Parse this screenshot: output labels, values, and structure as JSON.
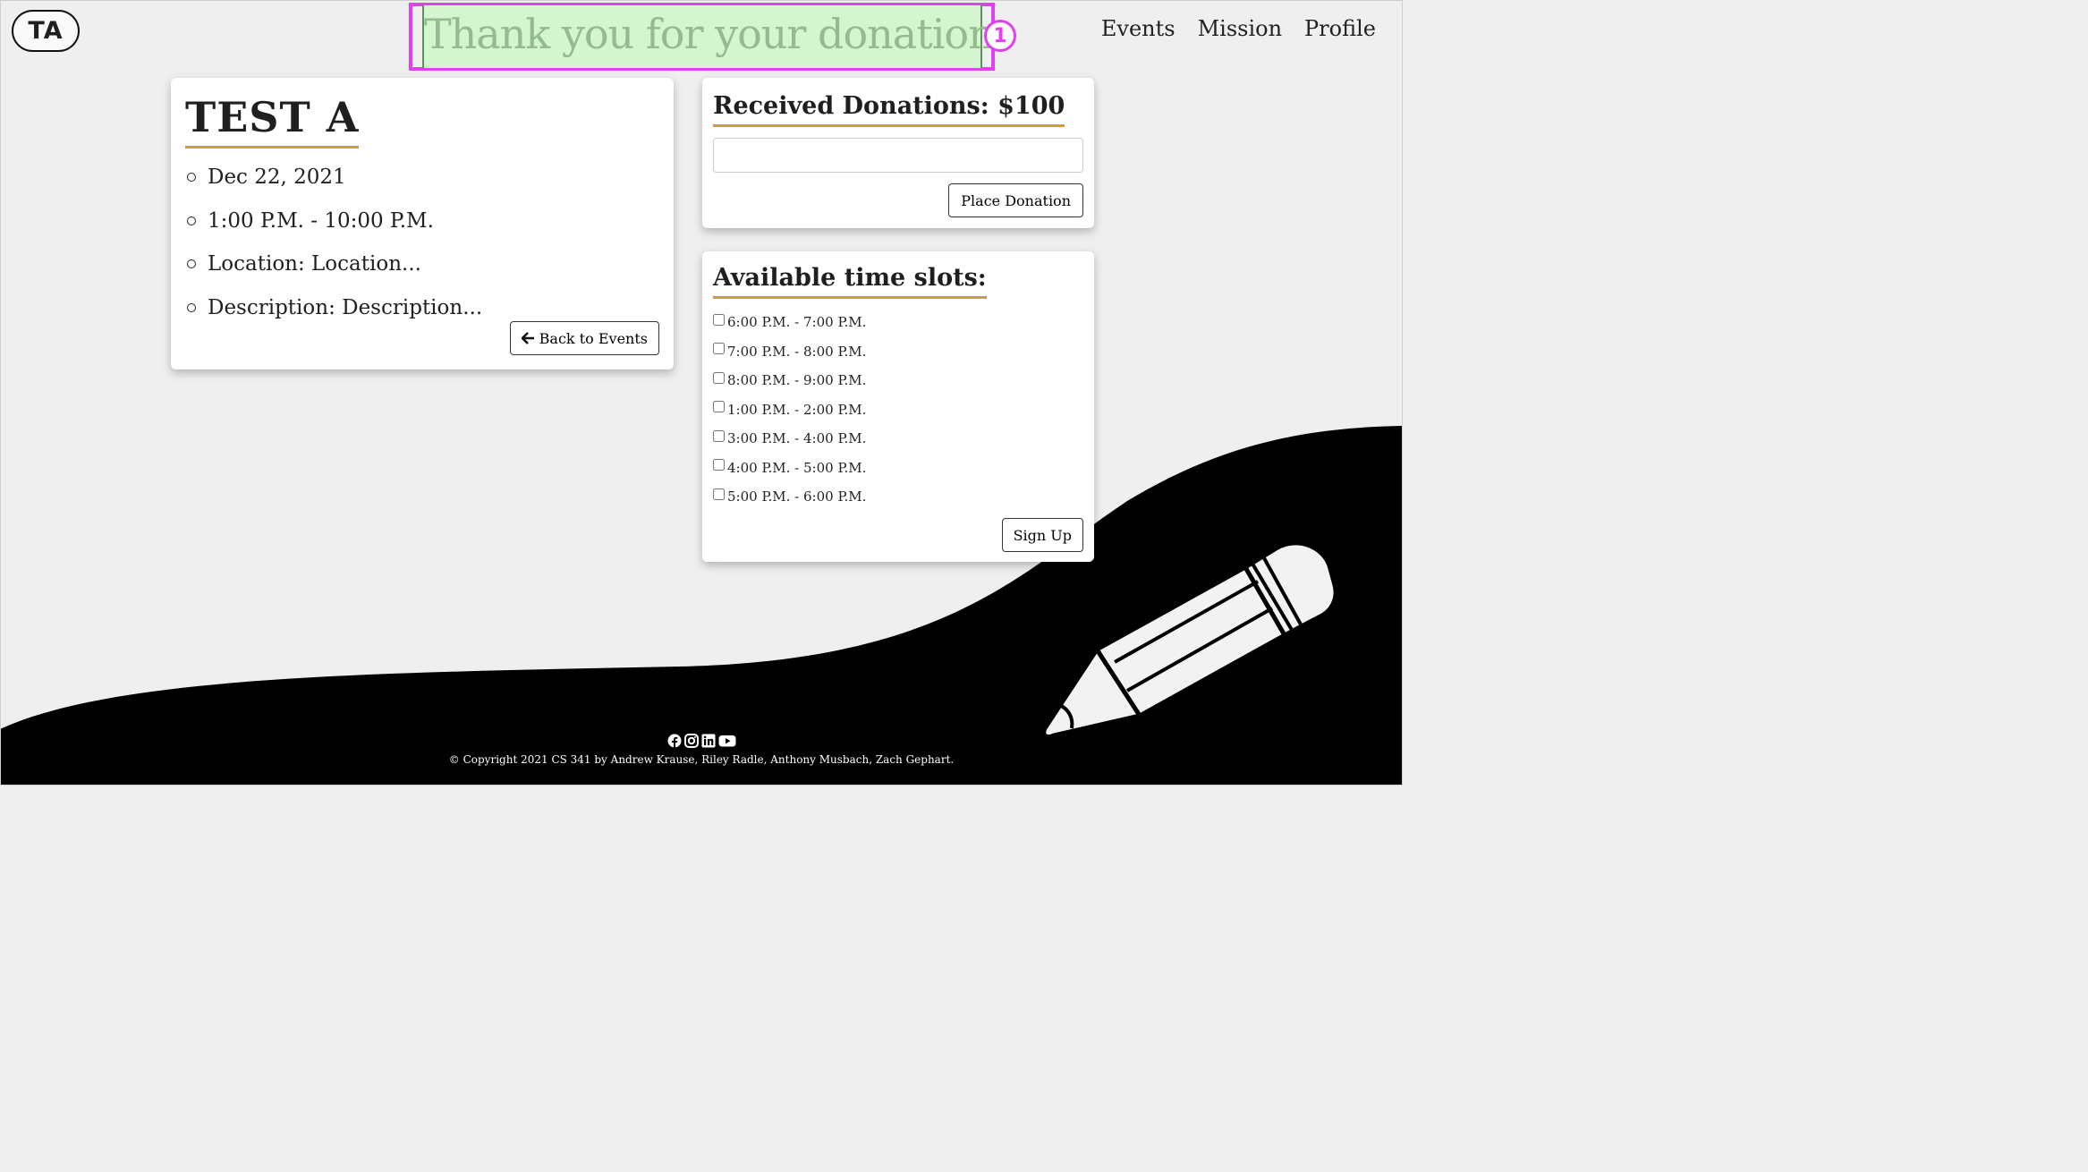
{
  "header": {
    "logo": "TA",
    "banner": "Thank you for your donation",
    "banner_badge": "1",
    "nav": [
      "Events",
      "Mission",
      "Profile"
    ]
  },
  "event": {
    "title": "TEST A",
    "date": "Dec 22, 2021",
    "time": "1:00 P.M. - 10:00 P.M.",
    "location": "Location: Location...",
    "description": "Description: Description...",
    "back_label": "Back to Events"
  },
  "donations": {
    "title": "Received Donations: $100",
    "input_value": "",
    "button_label": "Place Donation"
  },
  "slots": {
    "title": "Available time slots:",
    "items": [
      "6:00 P.M. - 7:00 P.M.",
      "7:00 P.M. - 8:00 P.M.",
      "8:00 P.M. - 9:00 P.M.",
      "1:00 P.M. - 2:00 P.M.",
      "3:00 P.M. - 4:00 P.M.",
      "4:00 P.M. - 5:00 P.M.",
      "5:00 P.M. - 6:00 P.M."
    ],
    "button_label": "Sign Up"
  },
  "footer": {
    "icons": [
      "facebook-icon",
      "instagram-icon",
      "linkedin-icon",
      "youtube-icon"
    ],
    "copyright": "© Copyright 2021 CS 341 by Andrew Krause, Riley Radle, Anthony Musbach, Zach Gephart."
  },
  "colors": {
    "accent_underline": "#e0913c",
    "highlight_border": "#e040f0",
    "banner_bg": "#d4f5d0",
    "banner_text": "#93bb8d"
  }
}
